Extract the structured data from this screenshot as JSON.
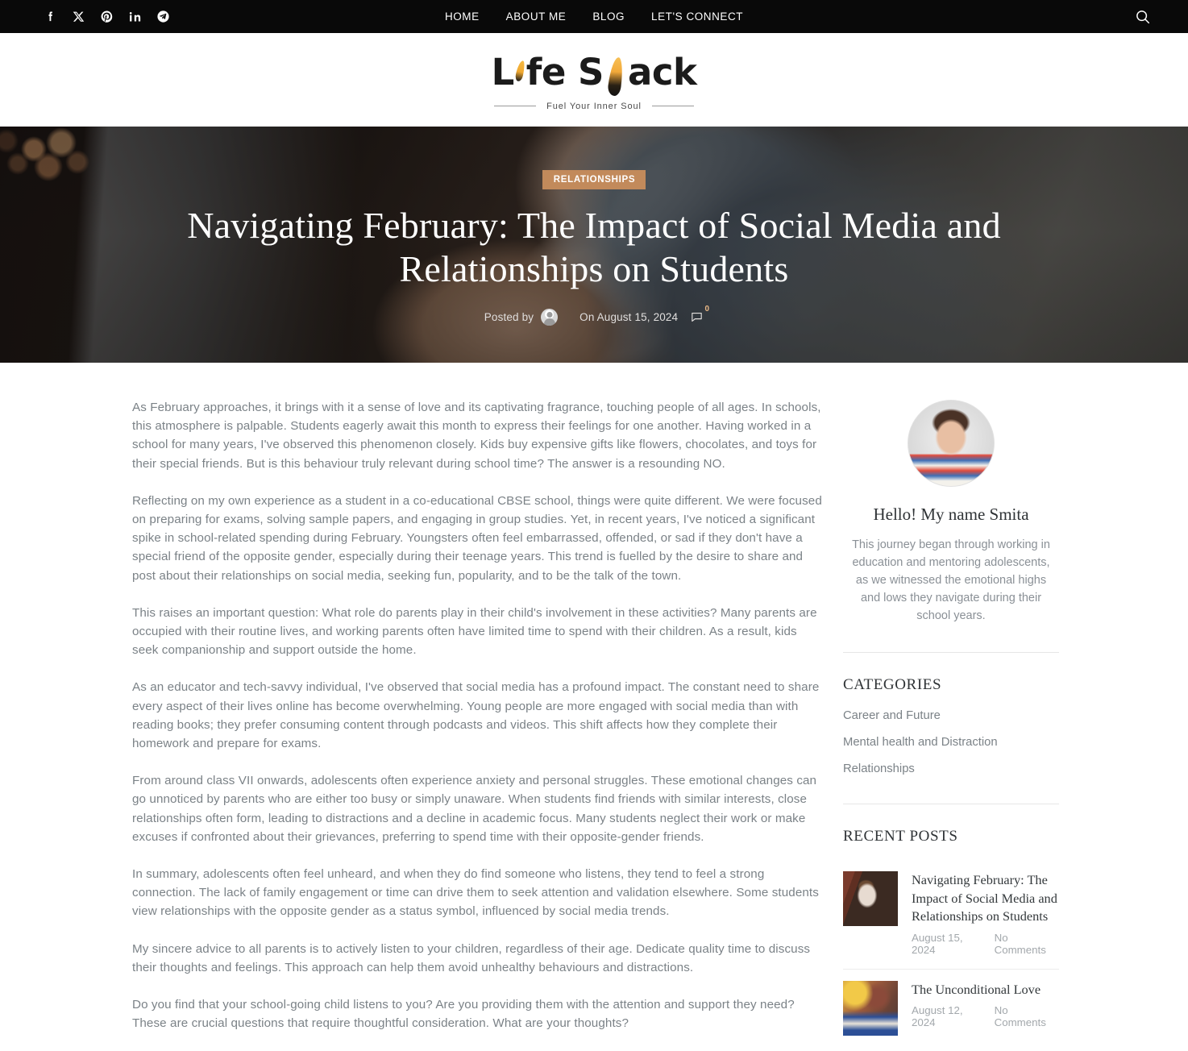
{
  "topbar": {
    "social": [
      {
        "name": "facebook-icon",
        "label": "Facebook"
      },
      {
        "name": "x-twitter-icon",
        "label": "X"
      },
      {
        "name": "pinterest-icon",
        "label": "Pinterest"
      },
      {
        "name": "linkedin-icon",
        "label": "LinkedIn"
      },
      {
        "name": "telegram-icon",
        "label": "Telegram"
      }
    ],
    "nav": [
      {
        "label": "HOME"
      },
      {
        "label": "ABOUT ME"
      },
      {
        "label": "BLOG"
      },
      {
        "label": "LET'S CONNECT"
      }
    ],
    "search_icon": "search-icon",
    "background": "#090909"
  },
  "logo": {
    "part1": "L",
    "part2": "fe S",
    "part3": "ack",
    "full_text": "Life Snack",
    "tagline": "Fuel Your Inner Soul",
    "flame_color": "#f0a830"
  },
  "hero": {
    "category": "RELATIONSHIPS",
    "category_color": "#c28a5b",
    "title": "Navigating February: The Impact of Social Media and Relationships on Students",
    "posted_by_label": "Posted by",
    "date_label": "On August 15, 2024",
    "comment_count": "0"
  },
  "article": {
    "paragraphs": [
      "As February approaches, it brings with it a sense of love and its captivating fragrance, touching people of all ages. In schools, this atmosphere is palpable. Students eagerly await this month to express their feelings for one another. Having worked in a school for many years, I've observed this phenomenon closely. Kids buy expensive gifts like flowers, chocolates, and toys for their special friends. But is this behaviour truly relevant during school time? The answer is a resounding NO.",
      "Reflecting on my own experience as a student in a co-educational CBSE school, things were quite different. We were focused on preparing for exams, solving sample papers, and engaging in group studies. Yet, in recent years, I've noticed a significant spike in school-related spending during February. Youngsters often feel embarrassed, offended, or sad if they don't have a special friend of the opposite gender, especially during their teenage years. This trend is fuelled by the desire to share and post about their relationships on social media, seeking fun, popularity, and to be the talk of the town.",
      "This raises an important question: What role do parents play in their child's involvement in these activities? Many parents are occupied with their routine lives, and working parents often have limited time to spend with their children. As a result, kids seek companionship and support outside the home.",
      "As an educator and tech-savvy individual, I've observed that social media has a profound impact. The constant need to share every aspect of their lives online has become overwhelming. Young people are more engaged with social media than with reading books; they prefer consuming content through podcasts and videos. This shift affects how they complete their homework and prepare for exams.",
      "From around class VII onwards, adolescents often experience anxiety and personal struggles. These emotional changes can go unnoticed by parents who are either too busy or simply unaware. When students find friends with similar interests, close relationships often form, leading to distractions and a decline in academic focus. Many students neglect their work or make excuses if confronted about their grievances, preferring to spend time with their opposite-gender friends.",
      "In summary, adolescents often feel unheard, and when they do find someone who listens, they tend to feel a strong connection. The lack of family engagement or time can drive them to seek attention and validation elsewhere. Some students view relationships with the opposite gender as a status symbol, influenced by social media trends.",
      "My sincere advice to all parents is to actively listen to your children, regardless of their age. Dedicate quality time to discuss their thoughts and feelings. This approach can help them avoid unhealthy behaviours and distractions.",
      "Do you find that your school-going child listens to you? Are you providing them with the attention and support they need? These are crucial questions that require thoughtful consideration. What are your thoughts?"
    ]
  },
  "sidebar": {
    "author": {
      "name": "Hello! My name Smita",
      "bio": "This journey began through working in education and mentoring adolescents, as we witnessed the emotional highs and lows they navigate during their school years."
    },
    "categories": {
      "heading": "CATEGORIES",
      "items": [
        {
          "label": "Career and Future"
        },
        {
          "label": "Mental health and Distraction"
        },
        {
          "label": "Relationships"
        }
      ]
    },
    "recent_posts": {
      "heading": "RECENT POSTS",
      "items": [
        {
          "title": "Navigating February: The Impact of Social Media and Relationships on Students",
          "date": "August 15, 2024",
          "comments": "No Comments"
        },
        {
          "title": "The Unconditional Love",
          "date": "August 12, 2024",
          "comments": "No Comments"
        }
      ]
    }
  }
}
